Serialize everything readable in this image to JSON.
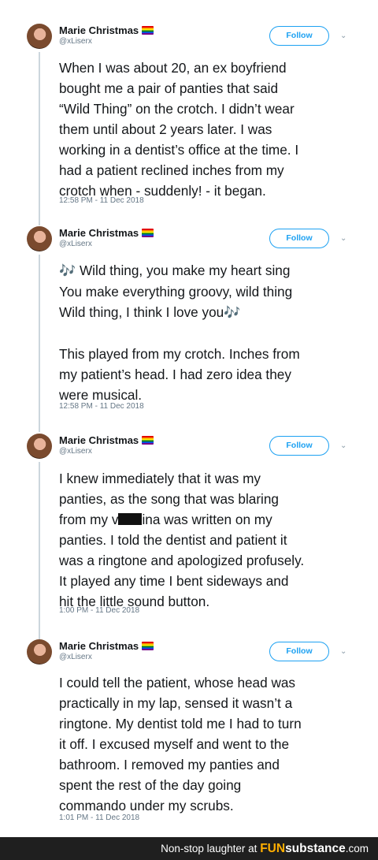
{
  "tweets": [
    {
      "user": {
        "name": "Marie Christmas",
        "handle": "@xLiserx",
        "flag_icon": "rainbow-flag-icon"
      },
      "follow_label": "Follow",
      "paragraphs": [
        [
          "When I was about 20, an ex boyfriend",
          "bought me a pair of panties that said",
          "“Wild Thing” on the crotch. I didn’t wear",
          "them until about 2 years later. I was",
          "working in a dentist’s office at the time. I",
          "had a patient reclined inches from my",
          "crotch when - suddenly! - it began."
        ]
      ],
      "timestamp": "12:58 PM - 11 Dec 2018"
    },
    {
      "user": {
        "name": "Marie Christmas",
        "handle": "@xLiserx",
        "flag_icon": "rainbow-flag-icon"
      },
      "follow_label": "Follow",
      "song": {
        "note_icon": "🎶",
        "line1": "Wild thing, you make my heart sing",
        "line2": "You make everything groovy, wild thing",
        "line3": "Wild thing, I think I love you"
      },
      "paragraphs": [
        [
          "This played from my crotch. Inches from",
          "my patient’s head. I had zero idea they",
          "were musical."
        ]
      ],
      "timestamp": "12:58 PM - 11 Dec 2018"
    },
    {
      "user": {
        "name": "Marie Christmas",
        "handle": "@xLiserx",
        "flag_icon": "rainbow-flag-icon"
      },
      "follow_label": "Follow",
      "lines_before": [
        "I knew immediately that it was my",
        "panties, as the song that was blaring"
      ],
      "redacted_line": {
        "prefix": "from my v",
        "suffix": "ina was written on my"
      },
      "lines_after": [
        "panties. I told the dentist and patient it",
        "was a ringtone and apologized profusely.",
        "It played any time I bent sideways and",
        "hit the little sound button."
      ],
      "timestamp": "1:00 PM - 11 Dec 2018"
    },
    {
      "user": {
        "name": "Marie Christmas",
        "handle": "@xLiserx",
        "flag_icon": "rainbow-flag-icon"
      },
      "follow_label": "Follow",
      "paragraphs": [
        [
          "I could tell the patient, whose head was",
          "practically in my lap, sensed it wasn’t a",
          "ringtone. My dentist told me I had to turn",
          "it off. I excused myself and went to the",
          "bathroom. I removed my panties and",
          "spent the rest of the day going",
          "commando under my scrubs."
        ]
      ],
      "timestamp": "1:01 PM - 11 Dec 2018"
    }
  ],
  "footer": {
    "text": "Non-stop laughter at",
    "brand_prefix": "FUN",
    "brand_suffix": "substance",
    "brand_tld": ".com"
  },
  "colors": {
    "follow_blue": "#1da1f2",
    "meta_gray": "#657786",
    "footer_bg": "#1f1f1f",
    "brand_orange": "#ffae00"
  }
}
